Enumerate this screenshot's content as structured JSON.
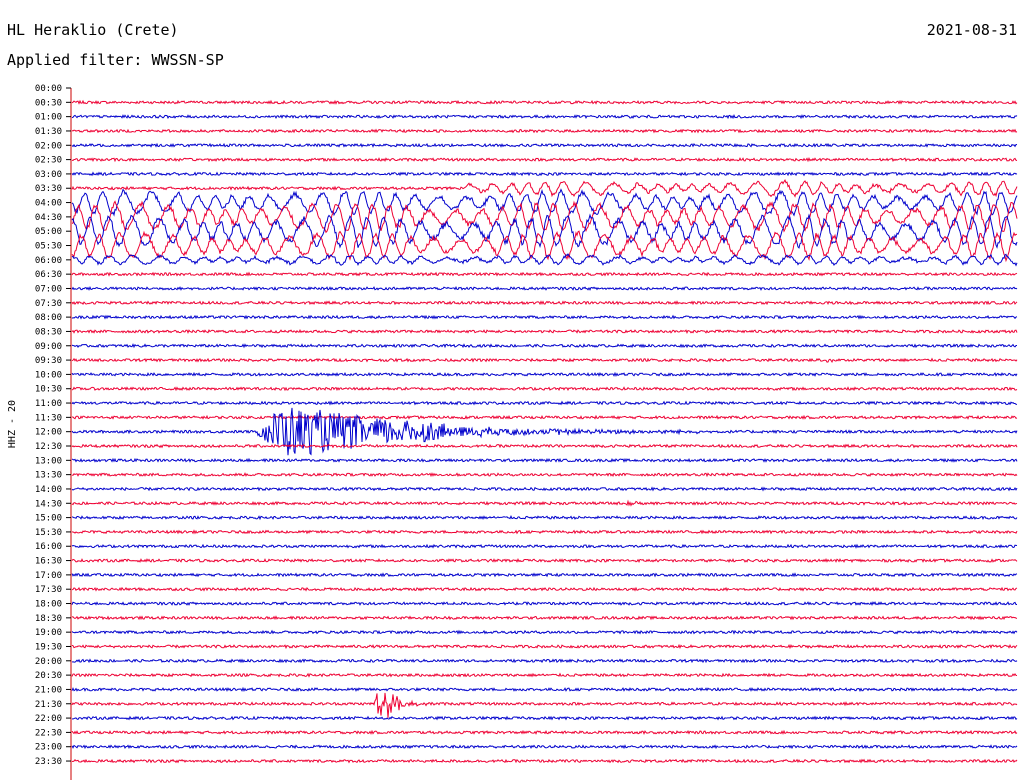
{
  "header": {
    "station": "HL Heraklio (Crete)",
    "date": "2021-08-31",
    "filter": "Applied filter: WWSSN-SP"
  },
  "chart_data": {
    "type": "line",
    "subtype": "helicorder-seismogram",
    "channel_label": "HHZ - 20",
    "tick_labels": [
      "00:00",
      "00:30",
      "01:00",
      "01:30",
      "02:00",
      "02:30",
      "03:00",
      "03:30",
      "04:00",
      "04:30",
      "05:00",
      "05:30",
      "06:00",
      "06:30",
      "07:00",
      "07:30",
      "08:00",
      "08:30",
      "09:00",
      "09:30",
      "10:00",
      "10:30",
      "11:00",
      "11:30",
      "12:00",
      "12:30",
      "13:00",
      "13:30",
      "14:00",
      "14:30",
      "15:00",
      "15:30",
      "16:00",
      "16:30",
      "17:00",
      "17:30",
      "18:00",
      "18:30",
      "19:00",
      "19:30",
      "20:00",
      "20:30",
      "21:00",
      "21:30",
      "22:00",
      "22:30",
      "23:00",
      "23:30"
    ],
    "trace_colors": [
      "#0000cc",
      "#ee0033"
    ],
    "line_duration_minutes": 30,
    "events": [
      {
        "line": "03:30",
        "start_min": 12.5,
        "end_min": 30,
        "kind": "surface-wave",
        "amp": 0.55
      },
      {
        "line": "04:00",
        "start_min": 0,
        "end_min": 30,
        "kind": "surface-wave",
        "amp": 0.9
      },
      {
        "line": "04:30",
        "start_min": 0,
        "end_min": 30,
        "kind": "surface-wave",
        "amp": 1.1
      },
      {
        "line": "05:00",
        "start_min": 0,
        "end_min": 30,
        "kind": "surface-wave",
        "amp": 1.2
      },
      {
        "line": "05:30",
        "start_min": 0,
        "end_min": 30,
        "kind": "surface-wave",
        "amp": 1.0
      },
      {
        "line": "06:00",
        "start_min": 0,
        "end_min": 30,
        "kind": "surface-wave",
        "amp": 0.35
      },
      {
        "line": "09:30",
        "start_min": 23.8,
        "end_min": 24.7,
        "kind": "local",
        "amp": 0.35
      },
      {
        "line": "12:00",
        "start_min": 5.8,
        "end_min": 20,
        "kind": "teleseism",
        "amp": 2.3
      },
      {
        "line": "14:30",
        "start_min": 17.6,
        "end_min": 18.3,
        "kind": "local",
        "amp": 0.3
      },
      {
        "line": "21:30",
        "start_min": 9.6,
        "end_min": 11.5,
        "kind": "local",
        "amp": 2.2
      }
    ]
  }
}
